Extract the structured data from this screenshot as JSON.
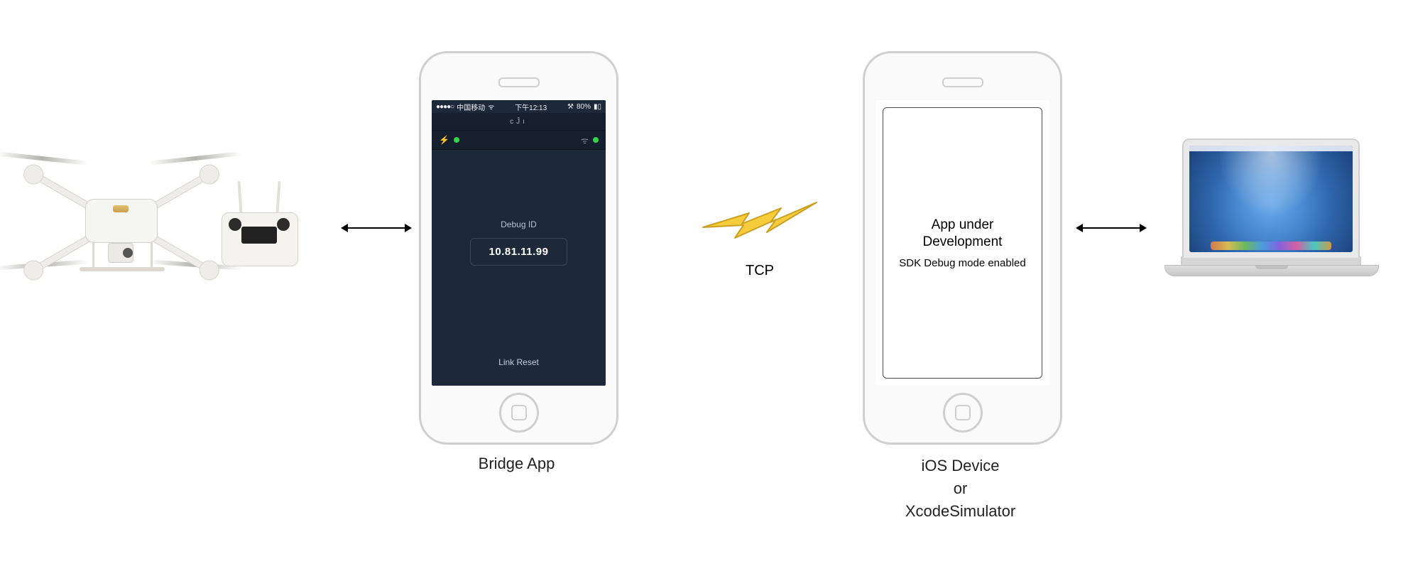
{
  "labels": {
    "bridge_caption": "Bridge App",
    "ios_caption_line1": "iOS Device",
    "ios_caption_line2": "or",
    "ios_caption_line3": "XcodeSimulator",
    "tcp": "TCP"
  },
  "bridge": {
    "status_bar": {
      "signal_dots": "●●●●○",
      "carrier": "中国移动",
      "wifi_glyph": "ᯤ",
      "time": "下午12:13",
      "bt_glyph": "⚒",
      "battery_pct": "80%",
      "battery_glyph": "▮▯"
    },
    "brand": "cĴı",
    "indicators": {
      "usb_glyph": "⚡",
      "wifi_glyph": "ᯤ"
    },
    "debug_label": "Debug ID",
    "debug_ip": "10.81.11.99",
    "link_reset": "Link Reset"
  },
  "dev_phone": {
    "title": "App under Development",
    "subtitle": "SDK Debug mode enabled"
  },
  "icons": {
    "drone": "drone-icon",
    "remote": "remote-controller-icon",
    "lightning": "lightning-icon",
    "laptop": "macbook-icon"
  }
}
